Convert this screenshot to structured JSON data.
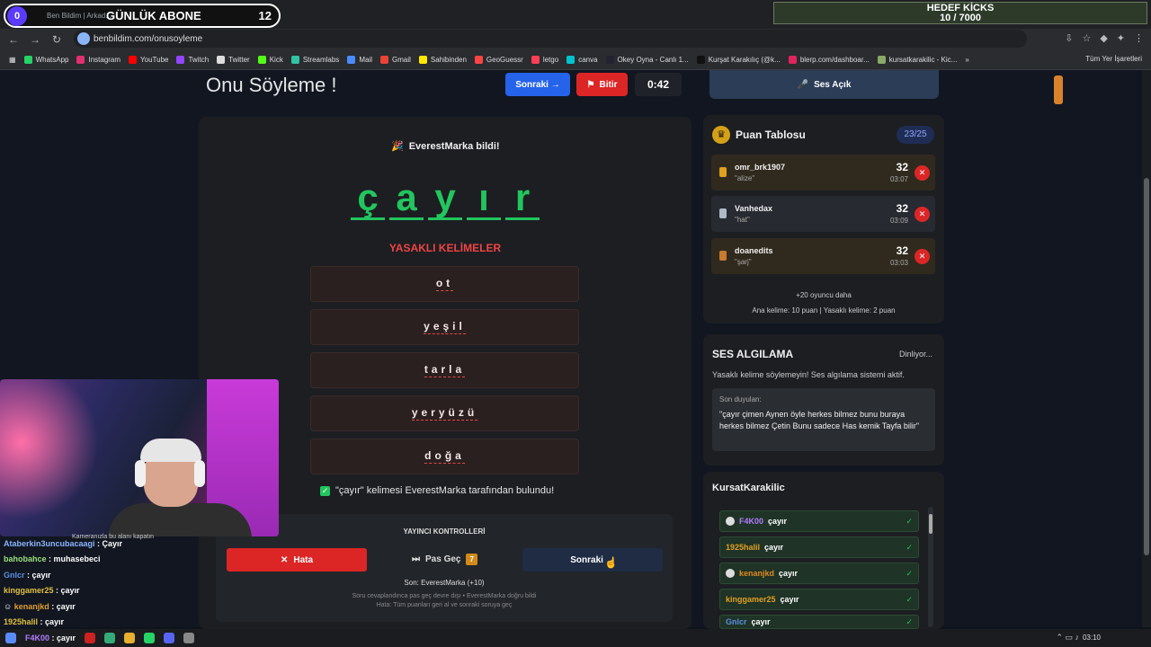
{
  "browser": {
    "tab_title": "Ben Bildim | Arkad...",
    "url": "benbildim.com/onusoyleme",
    "all_bookmarks": "Tüm Yer İşaretleri",
    "bookmarks": [
      "WhatsApp",
      "Instagram",
      "YouTube",
      "Twitch",
      "Twitter",
      "Kick",
      "Streamlabs",
      "Mail",
      "Gmail",
      "Sahibinden",
      "GeoGuessr",
      "letgo",
      "canva",
      "Okey Oyna - Canlı 1...",
      "Kurşat Karakılıç (@k...",
      "blerp.com/dashboar...",
      "kursatkarakilic - Kic..."
    ]
  },
  "stream_overlay": {
    "sub_count": "0",
    "daily_sub_title": "GÜNLÜK ABONE",
    "daily_sub_value": "12",
    "goal_title": "HEDEF KİCKS",
    "goal_value": "10 / 7000"
  },
  "header": {
    "title": "Onu Söyleme !",
    "next_label": "Sonraki →",
    "end_label": "Bitir",
    "timer": "0:42",
    "sound_label": "Ses Açık"
  },
  "game": {
    "solved_text": "EverestMarka bildi!",
    "letters": [
      "ç",
      "a",
      "y",
      "ı",
      "r"
    ],
    "forbidden_title": "YASAKLI KELİMELER",
    "forbidden": [
      "ot",
      "yeşil",
      "tarla",
      "yeryüzü",
      "doğa"
    ],
    "found_text": "\"çayır\" kelimesi EverestMarka tarafından bulundu!"
  },
  "controls": {
    "title": "YAYINCI KONTROLLERİ",
    "error_label": "Hata",
    "skip_label": "Pas Geç",
    "skip_count": "7",
    "next_label": "Sonraki →",
    "last": "Son: EverestMarka (+10)",
    "note1": "Soru cevaplandınca pas geç devre dışı • EverestMarka doğru bildi",
    "note2": "Hata: Tüm puanları geri al ve sonraki soruya geç"
  },
  "leaderboard": {
    "title": "Puan Tablosu",
    "badge": "23/25",
    "rows": [
      {
        "name": "omr_brk1907",
        "answer": "\"alize\"",
        "points": "32",
        "time": "03:07"
      },
      {
        "name": "Vanhedax",
        "answer": "\"hat\"",
        "points": "32",
        "time": "03:09"
      },
      {
        "name": "doanedits",
        "answer": "\"şarj\"",
        "points": "32",
        "time": "03:03"
      }
    ],
    "more": "+20 oyuncu daha",
    "rule": "Ana kelime: 10 puan | Yasaklı kelime: 2 puan"
  },
  "voice": {
    "title": "SES ALGILAMA",
    "status": "Dinliyor...",
    "desc": "Yasaklı kelime söylemeyin! Ses algılama sistemi aktif.",
    "heard_label": "Son duyulan:",
    "heard_text": "\"çayır çimen Aynen öyle herkes bilmez bunu buraya herkes bilmez Çetin Bunu sadece Has kemik Tayfa bilir\""
  },
  "chat": {
    "title": "KursatKarakilic",
    "rows": [
      {
        "user": "F4K00",
        "msg": "çayır",
        "color": "#b07cff",
        "paw": true
      },
      {
        "user": "1925halil",
        "msg": "çayır",
        "color": "#e0a020",
        "paw": false
      },
      {
        "user": "kenanjkd",
        "msg": "çayır",
        "color": "#e08a20",
        "paw": true
      },
      {
        "user": "kinggamer25",
        "msg": "çayır",
        "color": "#e0a020",
        "paw": false
      },
      {
        "user": "Gnlcr",
        "msg": "çayır",
        "color": "#5a8fe0",
        "paw": false
      }
    ]
  },
  "stream_chat": {
    "cam_label": "Kameranızla bu alanı kapatın",
    "messages": [
      {
        "user": "Ataberkin3uncubacaagi",
        "msg": ": Çayır",
        "color": "#8ab4ff"
      },
      {
        "user": "bahobahce",
        "msg": ": muhasebeci",
        "color": "#9be07a"
      },
      {
        "user": "Gnlcr",
        "msg": ": çayır",
        "color": "#5a8fe0"
      },
      {
        "user": "kinggamer25",
        "msg": ": çayır",
        "color": "#e0c040"
      },
      {
        "user": "kenanjkd",
        "msg": ": çayır",
        "color": "#e0a030"
      },
      {
        "user": "1925halil",
        "msg": ": çayır",
        "color": "#e0c040"
      },
      {
        "user": "F4K00",
        "msg": ": çayır",
        "color": "#b07cff"
      }
    ]
  },
  "taskbar": {
    "clock": "03:10"
  }
}
